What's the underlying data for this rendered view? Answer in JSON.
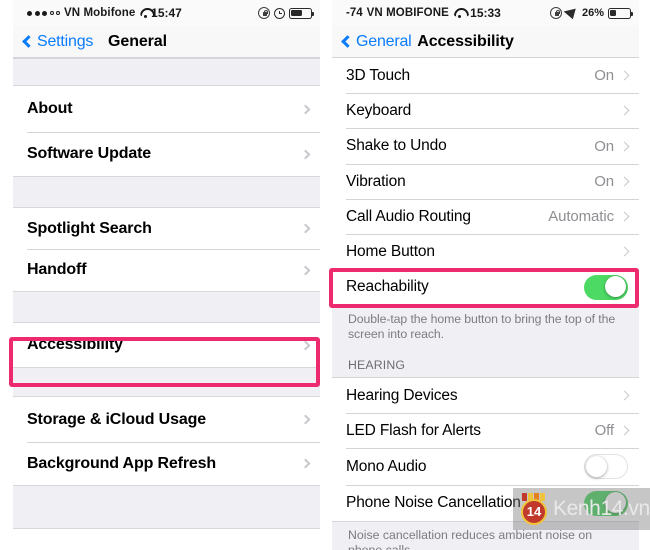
{
  "left_phone": {
    "status_bar": {
      "signal_dots_filled": 3,
      "signal_dots_empty": 2,
      "carrier": "VN Mobifone",
      "wifi_icon": "wifi-icon",
      "time": "15:47",
      "rotation_lock_icon": "rotation-lock-icon",
      "alarm_icon": "alarm-clock-icon",
      "battery_icon": "battery-icon",
      "battery_fill_percent": 58
    },
    "nav": {
      "back_label": "Settings",
      "back_icon": "chevron-left-icon",
      "title": "General"
    },
    "rows": [
      {
        "label": "About",
        "value": "",
        "accessory": "chevron"
      },
      {
        "label": "Software Update",
        "value": "",
        "accessory": "chevron"
      },
      {
        "label": "Spotlight Search",
        "value": "",
        "accessory": "chevron"
      },
      {
        "label": "Handoff",
        "value": "",
        "accessory": "chevron"
      },
      {
        "label": "Accessibility",
        "value": "",
        "accessory": "chevron"
      },
      {
        "label": "Storage & iCloud Usage",
        "value": "",
        "accessory": "chevron"
      },
      {
        "label": "Background App Refresh",
        "value": "",
        "accessory": "chevron"
      }
    ]
  },
  "right_phone": {
    "status_bar": {
      "rssi": "-74",
      "carrier": "VN MOBIFONE",
      "wifi_icon": "wifi-icon",
      "time": "15:33",
      "rotation_lock_icon": "rotation-lock-icon",
      "location_icon": "location-arrow-icon",
      "battery_percent": "26%",
      "battery_icon": "battery-icon",
      "battery_fill_percent": 26
    },
    "nav": {
      "back_label": "General",
      "back_icon": "chevron-left-icon",
      "title": "Accessibility"
    },
    "rows": [
      {
        "label": "3D Touch",
        "value": "On",
        "accessory": "chevron"
      },
      {
        "label": "Keyboard",
        "value": "",
        "accessory": "chevron"
      },
      {
        "label": "Shake to Undo",
        "value": "On",
        "accessory": "chevron"
      },
      {
        "label": "Vibration",
        "value": "On",
        "accessory": "chevron"
      },
      {
        "label": "Call Audio Routing",
        "value": "Automatic",
        "accessory": "chevron"
      },
      {
        "label": "Home Button",
        "value": "",
        "accessory": "chevron"
      },
      {
        "label": "Reachability",
        "value": "",
        "accessory": "toggle-on"
      }
    ],
    "reachability_note": "Double-tap the home button to bring the top of the screen into reach.",
    "hearing_header": "HEARING",
    "hearing_rows": [
      {
        "label": "Hearing Devices",
        "value": "",
        "accessory": "chevron"
      },
      {
        "label": "LED Flash for Alerts",
        "value": "Off",
        "accessory": "chevron"
      },
      {
        "label": "Mono Audio",
        "value": "",
        "accessory": "toggle-off"
      },
      {
        "label": "Phone Noise Cancellation",
        "value": "",
        "accessory": "toggle-on"
      }
    ],
    "noise_note": "Noise cancellation reduces ambient noise on phone calls"
  },
  "annotations": {
    "highlight_color": "#ee2a6e",
    "accessibility_box_target": "Accessibility",
    "reachability_box_target": "Reachability"
  },
  "watermark": {
    "badge_number": "14",
    "text": "Kenh14.vn"
  },
  "colors": {
    "accent_blue": "#0a7cff",
    "toggle_on_green": "#4cd964",
    "group_bg": "#efeff4",
    "value_gray": "#8e8e93",
    "highlight_pink": "#ee2a6e"
  }
}
